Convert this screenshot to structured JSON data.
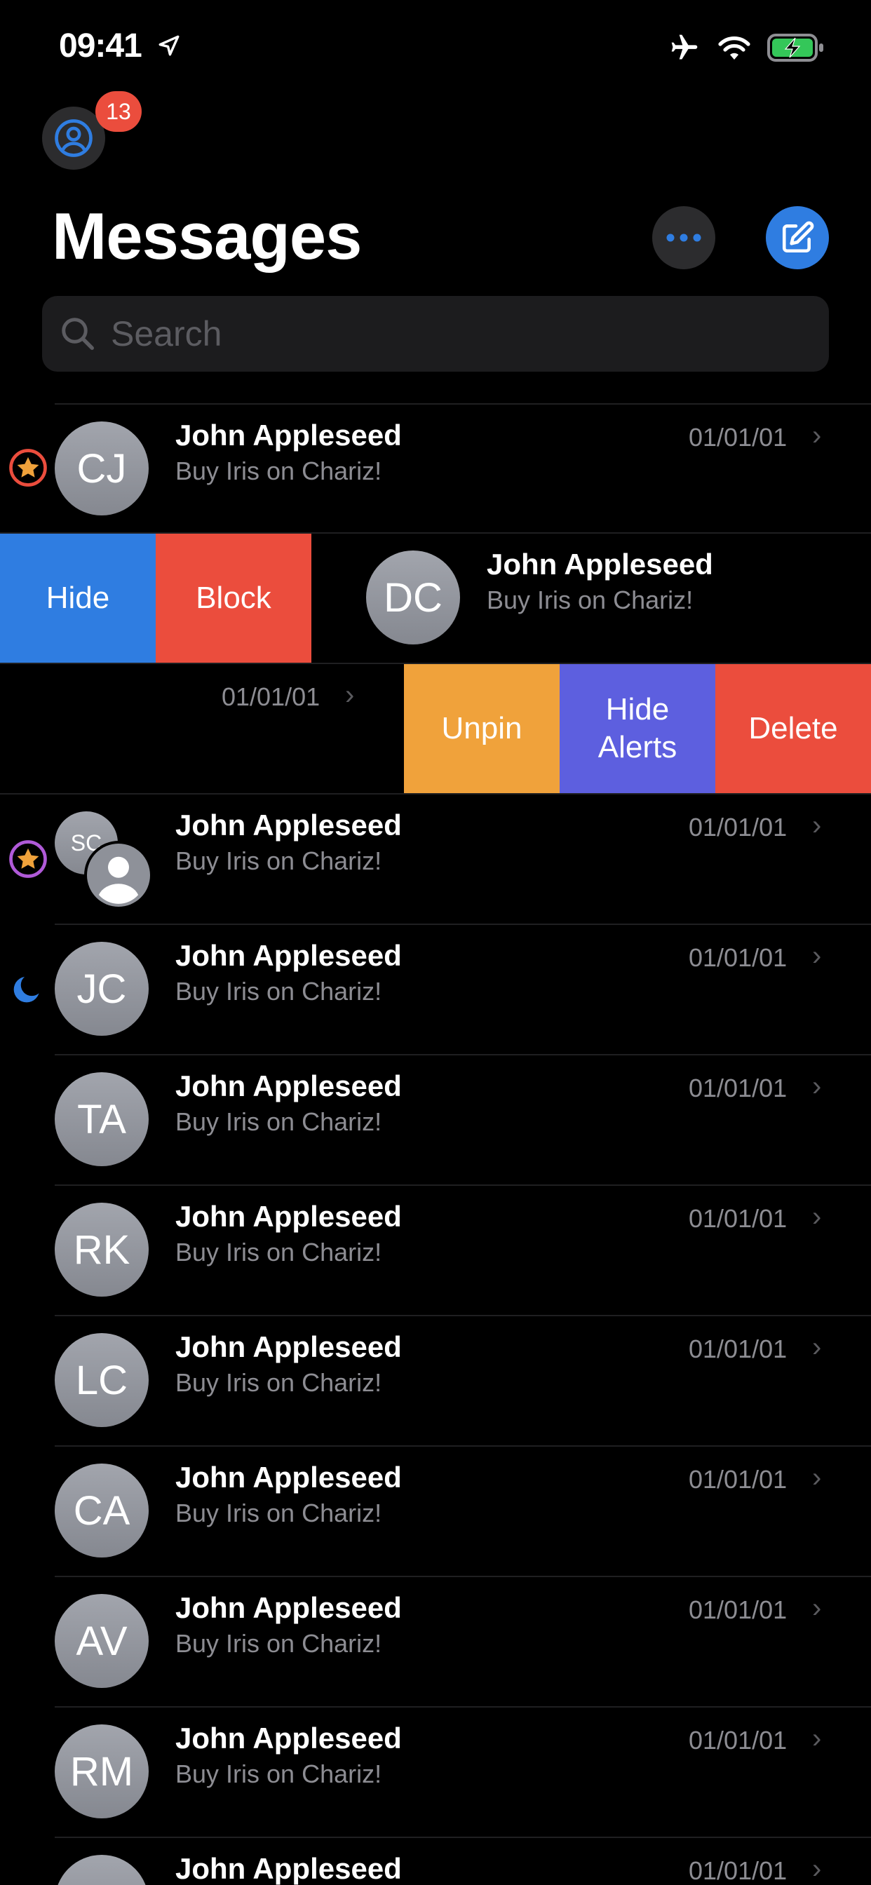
{
  "status_bar": {
    "time": "09:41"
  },
  "header": {
    "title": "Messages",
    "notification_count": "13"
  },
  "search": {
    "placeholder": "Search"
  },
  "swipe_left_actions": {
    "hide": "Hide",
    "block": "Block"
  },
  "swipe_right_actions": {
    "unpin": "Unpin",
    "hide_alerts": "Hide\nAlerts",
    "delete": "Delete"
  },
  "colors": {
    "blue": "#2f7de1",
    "red": "#eb4d3d",
    "orange": "#f0a23b",
    "indigo": "#5d5fdf",
    "purple": "#b05ad8"
  },
  "rows": [
    {
      "initials": "CJ",
      "name": "John Appleseed",
      "message": "Buy Iris on Chariz!",
      "date": "01/01/01",
      "indicator": "star-orange"
    },
    {
      "initials": "DC",
      "name": "John Appleseed",
      "message": "Buy Iris on Chariz!",
      "date": "",
      "indicator": ""
    },
    {
      "initials": "",
      "name": "",
      "message": "",
      "date": "01/01/01",
      "indicator": ""
    },
    {
      "initials": "SC",
      "name": "John Appleseed",
      "message": "Buy Iris on Chariz!",
      "date": "01/01/01",
      "indicator": "star-purple"
    },
    {
      "initials": "JC",
      "name": "John Appleseed",
      "message": "Buy Iris on Chariz!",
      "date": "01/01/01",
      "indicator": "moon-blue"
    },
    {
      "initials": "TA",
      "name": "John Appleseed",
      "message": "Buy Iris on Chariz!",
      "date": "01/01/01",
      "indicator": ""
    },
    {
      "initials": "RK",
      "name": "John Appleseed",
      "message": "Buy Iris on Chariz!",
      "date": "01/01/01",
      "indicator": ""
    },
    {
      "initials": "LC",
      "name": "John Appleseed",
      "message": "Buy Iris on Chariz!",
      "date": "01/01/01",
      "indicator": ""
    },
    {
      "initials": "CA",
      "name": "John Appleseed",
      "message": "Buy Iris on Chariz!",
      "date": "01/01/01",
      "indicator": ""
    },
    {
      "initials": "AV",
      "name": "John Appleseed",
      "message": "Buy Iris on Chariz!",
      "date": "01/01/01",
      "indicator": ""
    },
    {
      "initials": "RM",
      "name": "John Appleseed",
      "message": "Buy Iris on Chariz!",
      "date": "01/01/01",
      "indicator": ""
    },
    {
      "initials": "",
      "name": "John Appleseed",
      "message": "",
      "date": "01/01/01",
      "indicator": ""
    }
  ]
}
